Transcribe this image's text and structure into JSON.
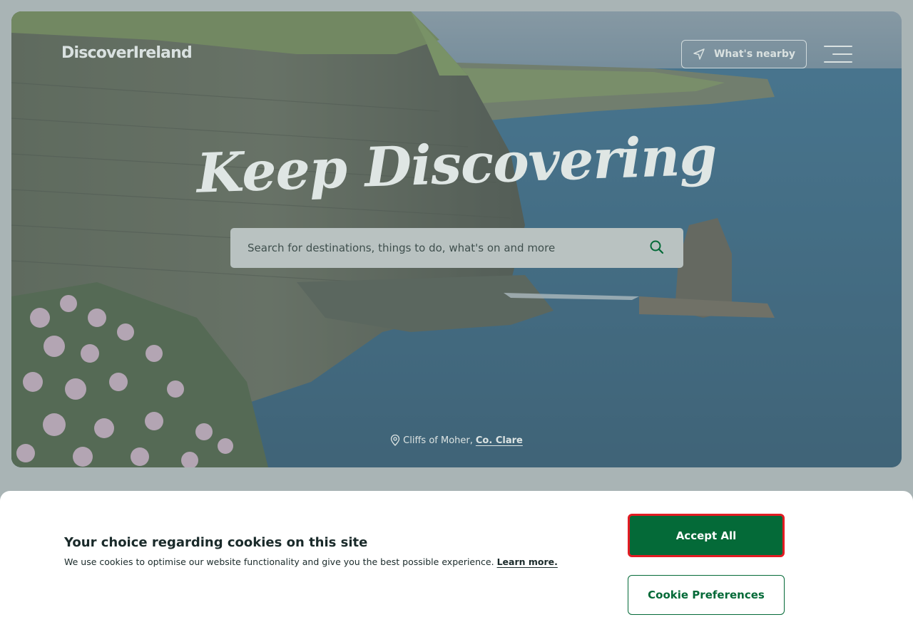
{
  "header": {
    "logo": "DiscoverIreland",
    "nearby_label": "What's nearby"
  },
  "hero": {
    "headline": "Keep Discovering",
    "image_alt": "Cliffs of Moher coastline with sea pink flowers"
  },
  "search": {
    "placeholder": "Search for destinations, things to do, what's on and more"
  },
  "location": {
    "place": "Cliffs of Moher,",
    "county": "Co. Clare"
  },
  "cookie_banner": {
    "title": "Your choice regarding cookies on this site",
    "text": "We use cookies to optimise our website functionality and give you the best possible experience.",
    "learn_more": "Learn more.",
    "accept_label": "Accept All",
    "preferences_label": "Cookie Preferences"
  },
  "colors": {
    "brand_green": "#046a38",
    "highlight_red": "#e31b23",
    "sea_blue": "#2f6a8c"
  },
  "icons": [
    "navigation-arrow-icon",
    "menu-icon",
    "search-icon",
    "location-pin-icon"
  ]
}
